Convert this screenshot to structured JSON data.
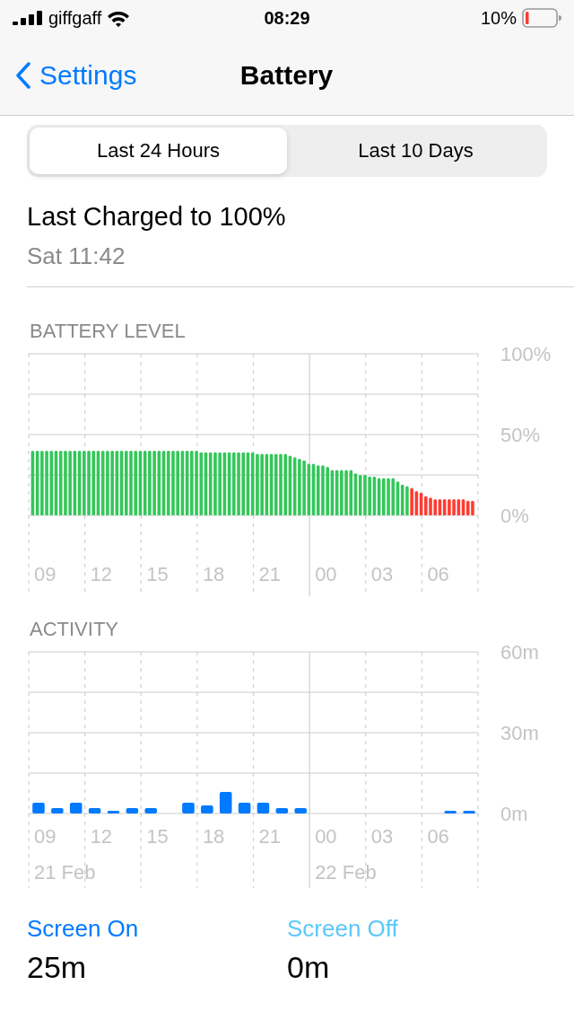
{
  "status_bar": {
    "carrier": "giffgaff",
    "time": "08:29",
    "battery": "10%"
  },
  "nav": {
    "back": "Settings",
    "title": "Battery"
  },
  "segments": [
    {
      "label": "Last 24 Hours",
      "selected": true
    },
    {
      "label": "Last 10 Days",
      "selected": false
    }
  ],
  "last_charged": {
    "title": "Last Charged to 100%",
    "time": "Sat 11:42"
  },
  "battery_level": {
    "title": "BATTERY LEVEL",
    "chart_data": {
      "type": "bar",
      "ylim": [
        0,
        100
      ],
      "yticks": [
        {
          "value": 0,
          "label": "0%"
        },
        {
          "value": 50,
          "label": "50%"
        },
        {
          "value": 100,
          "label": "100%"
        }
      ],
      "series": [
        {
          "color": "#34c759",
          "values": [
            40,
            40,
            40,
            40,
            40,
            40,
            40,
            40,
            40,
            40,
            40,
            40,
            40,
            40,
            40,
            40,
            40,
            40,
            40,
            40,
            40,
            40,
            40,
            40,
            40,
            40,
            40,
            40,
            40,
            40,
            40,
            40,
            40,
            40,
            40,
            40,
            39,
            39,
            39,
            39,
            39,
            39,
            39,
            39,
            39,
            39,
            39,
            39,
            38,
            38,
            38,
            38,
            38,
            38,
            38,
            37,
            36,
            35,
            34,
            32,
            32,
            31,
            31,
            30,
            28,
            28,
            28,
            28,
            28,
            26,
            25,
            25,
            24,
            24,
            23,
            23,
            23,
            23,
            21,
            19,
            18,
            null,
            null,
            null,
            null,
            null,
            null,
            null,
            null,
            null,
            null,
            null,
            null,
            null,
            null
          ]
        },
        {
          "color": "#ff3b30",
          "values": [
            null,
            null,
            null,
            null,
            null,
            null,
            null,
            null,
            null,
            null,
            null,
            null,
            null,
            null,
            null,
            null,
            null,
            null,
            null,
            null,
            null,
            null,
            null,
            null,
            null,
            null,
            null,
            null,
            null,
            null,
            null,
            null,
            null,
            null,
            null,
            null,
            null,
            null,
            null,
            null,
            null,
            null,
            null,
            null,
            null,
            null,
            null,
            null,
            null,
            null,
            null,
            null,
            null,
            null,
            null,
            null,
            null,
            null,
            null,
            null,
            null,
            null,
            null,
            null,
            null,
            null,
            null,
            null,
            null,
            null,
            null,
            null,
            null,
            null,
            null,
            null,
            null,
            null,
            null,
            null,
            null,
            17,
            15,
            14,
            12,
            11,
            10,
            10,
            10,
            10,
            10,
            10,
            10,
            9,
            9
          ]
        }
      ]
    },
    "hour_labels": [
      "09",
      "12",
      "15",
      "18",
      "21",
      "00",
      "03",
      "06"
    ]
  },
  "activity": {
    "title": "ACTIVITY",
    "chart_data": {
      "type": "bar",
      "ylim": [
        0,
        60
      ],
      "yticks": [
        {
          "value": 0,
          "label": "0m"
        },
        {
          "value": 30,
          "label": "30m"
        },
        {
          "value": 60,
          "label": "60m"
        }
      ],
      "series": [
        {
          "color": "#007aff",
          "values": [
            4,
            2,
            4,
            2,
            1,
            2,
            2,
            0,
            4,
            3,
            8,
            4,
            4,
            2,
            2,
            0,
            0,
            0,
            0,
            0,
            0,
            0,
            1,
            1
          ]
        }
      ]
    },
    "hour_labels": [
      "09",
      "12",
      "15",
      "18",
      "21",
      "00",
      "03",
      "06"
    ],
    "dates": [
      "21 Feb",
      "22 Feb"
    ]
  },
  "summary": [
    {
      "label": "Screen On",
      "value": "25m",
      "color": "#007aff"
    },
    {
      "label": "Screen Off",
      "value": "0m",
      "color": "#5ac8fa"
    }
  ]
}
